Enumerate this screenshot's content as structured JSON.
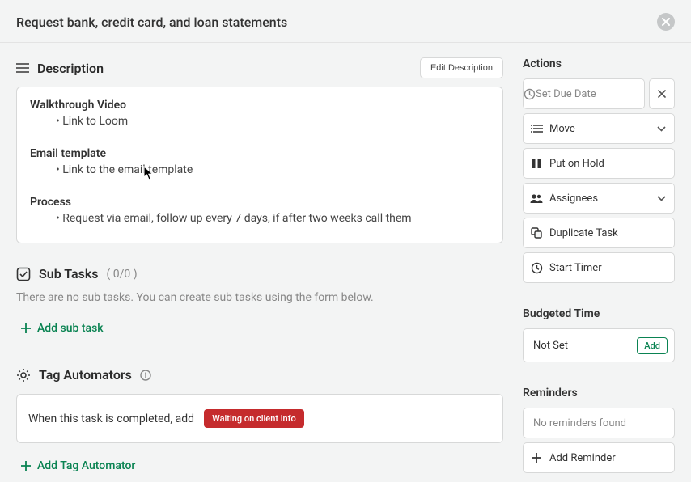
{
  "header": {
    "title": "Request bank, credit card, and loan statements"
  },
  "description": {
    "section_title": "Description",
    "edit_label": "Edit Description",
    "h1": "Walkthrough Video",
    "l1": "• Link to Loom",
    "h2": "Email template",
    "l2": "• Link to the email template",
    "h3": "Process",
    "l3": "• Request via email, follow up every 7 days, if after two weeks call them"
  },
  "subtasks": {
    "title": "Sub Tasks",
    "count": "( 0/0 )",
    "empty": "There are no sub tasks. You can create sub tasks using the form below.",
    "add_label": "Add sub task"
  },
  "tag_automators": {
    "title": "Tag Automators",
    "rule_text": "When this task is completed,  add",
    "pill": "Waiting on client info",
    "add_label": "Add Tag Automator"
  },
  "actions": {
    "heading": "Actions",
    "due_placeholder": "Set Due Date",
    "move": "Move",
    "hold": "Put on Hold",
    "assignees": "Assignees",
    "duplicate": "Duplicate Task",
    "timer": "Start Timer"
  },
  "budget": {
    "heading": "Budgeted Time",
    "value": "Not Set",
    "add": "Add"
  },
  "reminders": {
    "heading": "Reminders",
    "empty": "No reminders found",
    "add": "Add Reminder"
  }
}
